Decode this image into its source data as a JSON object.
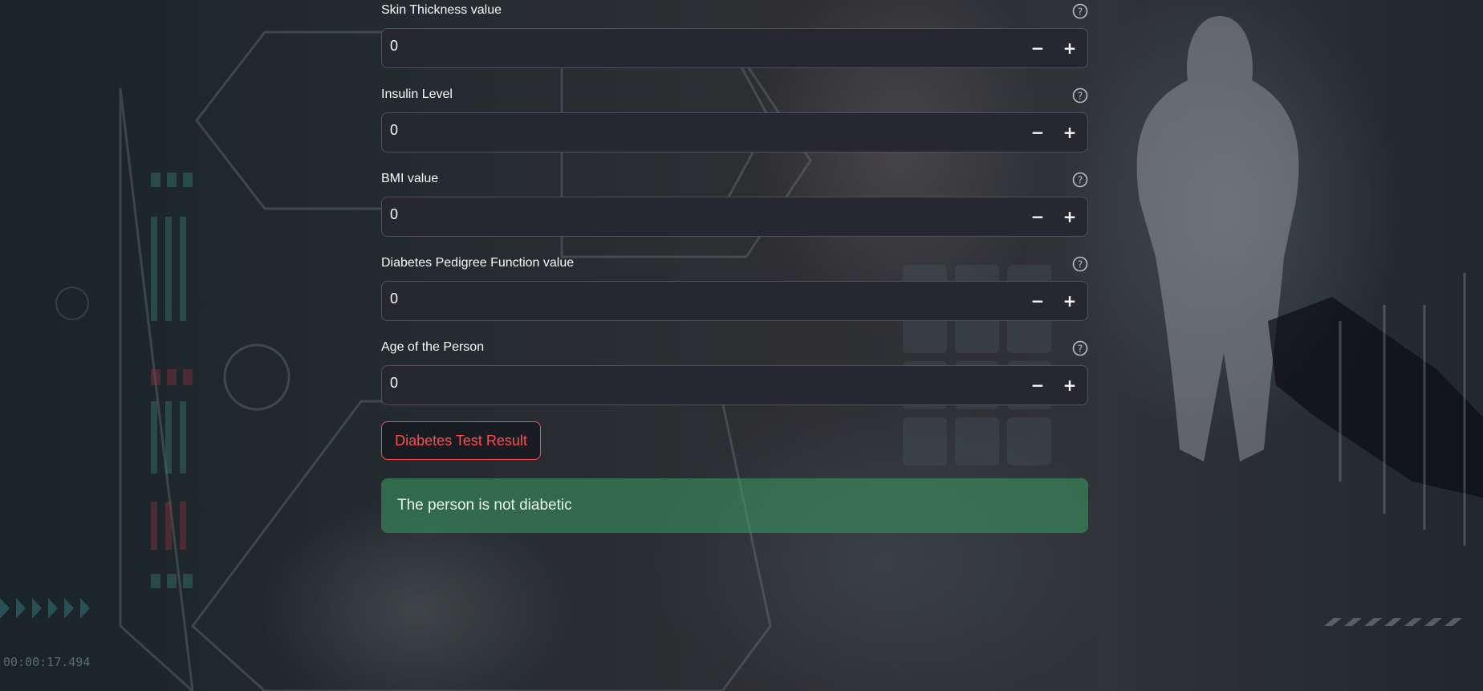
{
  "fields": [
    {
      "label": "Skin Thickness value",
      "value": "0"
    },
    {
      "label": "Insulin Level",
      "value": "0"
    },
    {
      "label": "BMI value",
      "value": "0"
    },
    {
      "label": "Diabetes Pedigree Function value",
      "value": "0"
    },
    {
      "label": "Age of the Person",
      "value": "0"
    }
  ],
  "stepper": {
    "minus": "−",
    "plus": "+"
  },
  "actions": {
    "result_button": "Diabetes Test Result"
  },
  "result": {
    "message": "The person is not diabetic",
    "status_color": "#3d9d62"
  },
  "background": {
    "hud_time": "00:00:17.494"
  },
  "colors": {
    "accent": "#ff4b4b",
    "input_bg": "#262730",
    "text": "#fafafa"
  },
  "icons": {
    "help": "help-circle-icon"
  }
}
